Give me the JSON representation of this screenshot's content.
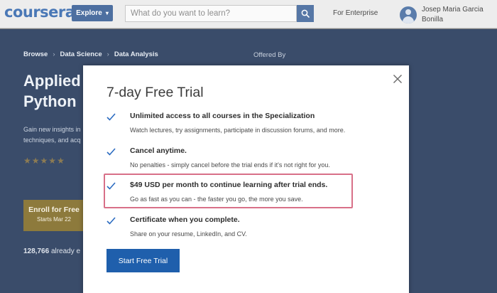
{
  "header": {
    "logo": "coursera",
    "explore_label": "Explore",
    "search_placeholder": "What do you want to learn?",
    "search_value": "",
    "enterprise_label": "For Enterprise",
    "user_name_line1": "Josep Maria Garcia",
    "user_name_line2": "Bonilla"
  },
  "background_page": {
    "breadcrumb": [
      "Browse",
      "Data Science",
      "Data Analysis"
    ],
    "offered_by": "Offered By",
    "title_line1": "Applied",
    "title_line2": "Python",
    "desc_line1": "Gain new insights in",
    "desc_line2": "techniques, and acq",
    "rating_stars": 4.5,
    "enroll_label": "Enroll for Free",
    "enroll_sub": "Starts Mar 22",
    "enrolled_count": "128,766",
    "enrolled_text": "already e"
  },
  "modal": {
    "title": "7-day Free Trial",
    "benefits": [
      {
        "title": "Unlimited access to all courses in the Specialization",
        "desc": "Watch lectures, try assignments, participate in discussion forums, and more."
      },
      {
        "title": "Cancel anytime.",
        "desc": "No penalties - simply cancel before the trial ends if it's not right for you."
      },
      {
        "title": "$49 USD per month to continue learning after trial ends.",
        "desc": "Go as fast as you can - the faster you go, the more you save."
      },
      {
        "title": "Certificate when you complete.",
        "desc": "Share on your resume, LinkedIn, and CV."
      }
    ],
    "highlighted_benefit": 2,
    "start_button": "Start Free Trial"
  },
  "colors": {
    "brand_blue": "#4a78b6",
    "button_blue": "#1f5fac",
    "check_blue": "#2c6cc1",
    "highlight_border": "#d87088",
    "overlay_page": "#3a4c6a"
  },
  "icons": [
    "search-icon",
    "close-icon",
    "checkmark-icon",
    "user-avatar-icon",
    "chevron-down-icon",
    "star-icon"
  ]
}
